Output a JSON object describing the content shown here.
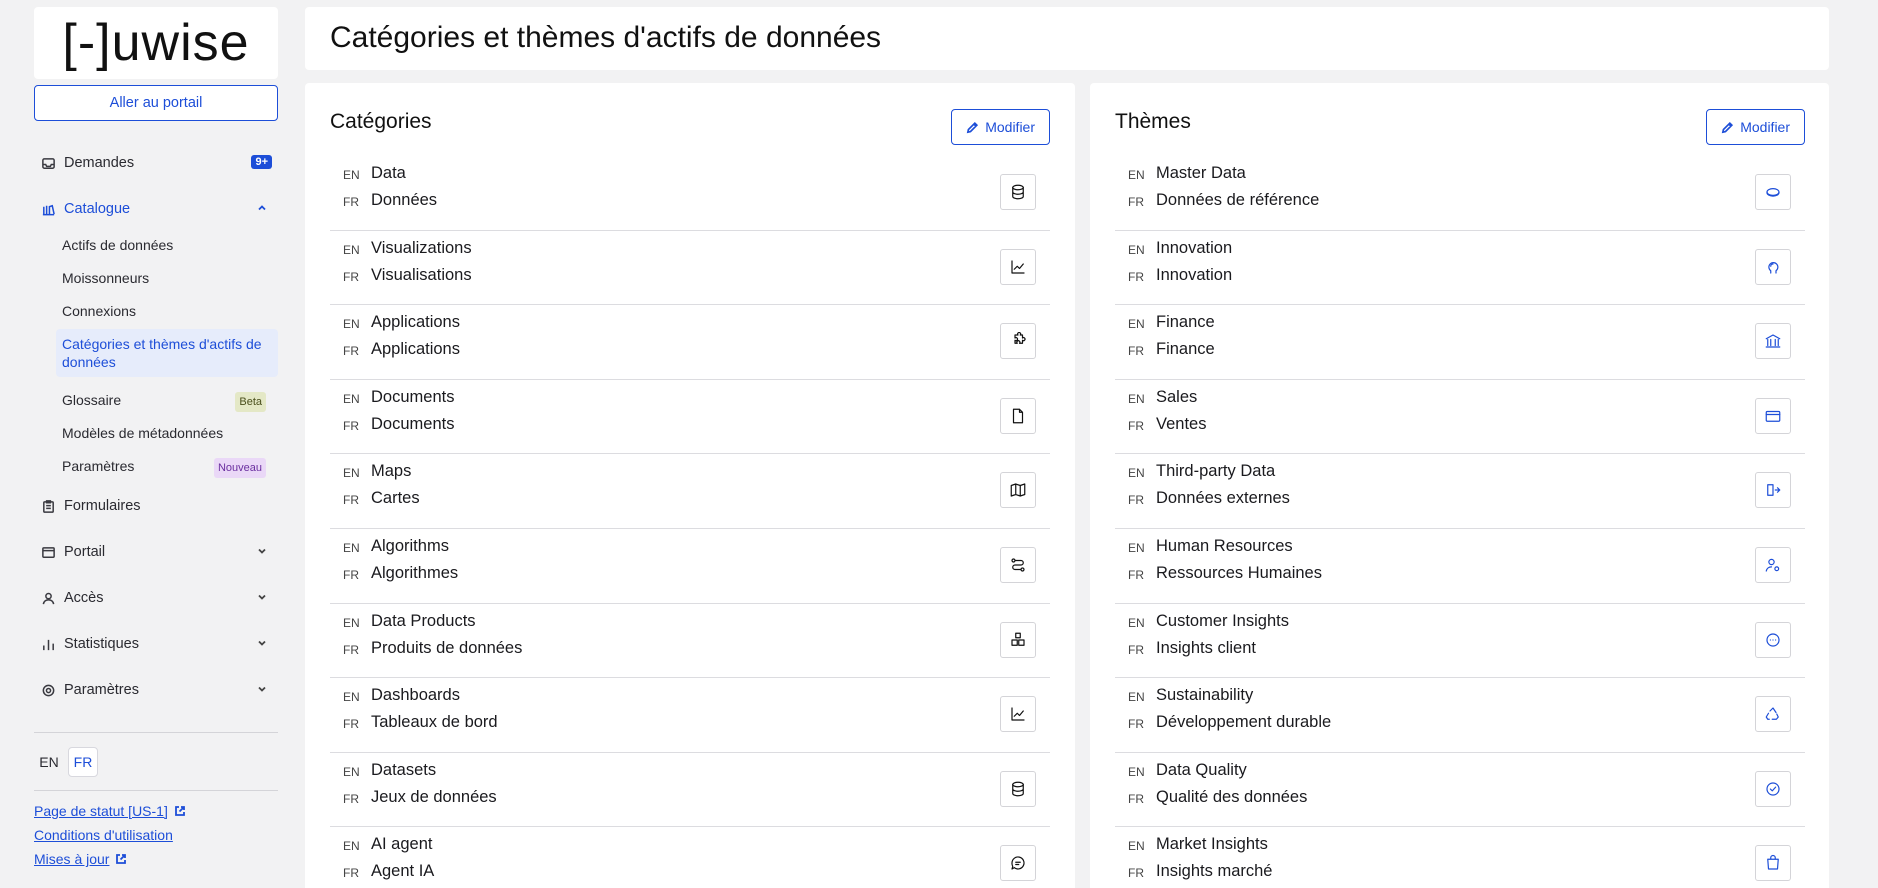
{
  "sidebar": {
    "logo": "[-]uwise",
    "portal_button": "Aller au portail",
    "nav": {
      "requests": {
        "label": "Demandes",
        "badge": "9+"
      },
      "catalog": {
        "label": "Catalogue"
      },
      "forms": {
        "label": "Formulaires"
      },
      "portal": {
        "label": "Portail"
      },
      "access": {
        "label": "Accès"
      },
      "stats": {
        "label": "Statistiques"
      },
      "settings": {
        "label": "Paramètres"
      }
    },
    "catalog_items": {
      "assets": "Actifs de données",
      "harvesters": "Moissonneurs",
      "connections": "Connexions",
      "categories": "Catégories et thèmes d'actifs de données",
      "glossary": "Glossaire",
      "glossary_tag": "Beta",
      "metadata_models": "Modèles de métadonnées",
      "params": "Paramètres",
      "params_tag": "Nouveau"
    },
    "languages": {
      "en": "EN",
      "fr": "FR",
      "active": "FR"
    },
    "footer": {
      "status": "Page de statut [US-1]",
      "terms": "Conditions d'utilisation",
      "updates": "Mises à jour"
    }
  },
  "header": {
    "title": "Catégories et thèmes d'actifs de données"
  },
  "categories": {
    "title": "Catégories",
    "edit_label": "Modifier",
    "lang_en": "EN",
    "lang_fr": "FR",
    "items": [
      {
        "en": "Data",
        "fr": "Données",
        "icon": "database-icon"
      },
      {
        "en": "Visualizations",
        "fr": "Visualisations",
        "icon": "line-chart-icon"
      },
      {
        "en": "Applications",
        "fr": "Applications",
        "icon": "puzzle-icon"
      },
      {
        "en": "Documents",
        "fr": "Documents",
        "icon": "file-icon"
      },
      {
        "en": "Maps",
        "fr": "Cartes",
        "icon": "map-icon"
      },
      {
        "en": "Algorithms",
        "fr": "Algorithmes",
        "icon": "route-icon"
      },
      {
        "en": "Data Products",
        "fr": "Produits de données",
        "icon": "boxes-icon"
      },
      {
        "en": "Dashboards",
        "fr": "Tableaux de bord",
        "icon": "line-chart-icon"
      },
      {
        "en": "Datasets",
        "fr": "Jeux de données",
        "icon": "database-icon"
      },
      {
        "en": "AI agent",
        "fr": "Agent IA",
        "icon": "message-icon"
      }
    ]
  },
  "themes": {
    "title": "Thèmes",
    "edit_label": "Modifier",
    "lang_en": "EN",
    "lang_fr": "FR",
    "items": [
      {
        "en": "Master Data",
        "fr": "Données de référence",
        "icon": "disc-icon"
      },
      {
        "en": "Innovation",
        "fr": "Innovation",
        "icon": "brain-icon"
      },
      {
        "en": "Finance",
        "fr": "Finance",
        "icon": "bank-icon"
      },
      {
        "en": "Sales",
        "fr": "Ventes",
        "icon": "wallet-icon"
      },
      {
        "en": "Third-party Data",
        "fr": "Données externes",
        "icon": "export-icon"
      },
      {
        "en": "Human Resources",
        "fr": "Ressources Humaines",
        "icon": "user-cog-icon"
      },
      {
        "en": "Customer Insights",
        "fr": "Insights client",
        "icon": "chat-bubble-icon"
      },
      {
        "en": "Sustainability",
        "fr": "Développement durable",
        "icon": "recycle-icon"
      },
      {
        "en": "Data Quality",
        "fr": "Qualité des données",
        "icon": "check-circle-icon"
      },
      {
        "en": "Market Insights",
        "fr": "Insights marché",
        "icon": "shopping-bag-icon"
      }
    ]
  },
  "colors": {
    "accent": "#1d4ed8",
    "background": "#f2f2f3"
  }
}
